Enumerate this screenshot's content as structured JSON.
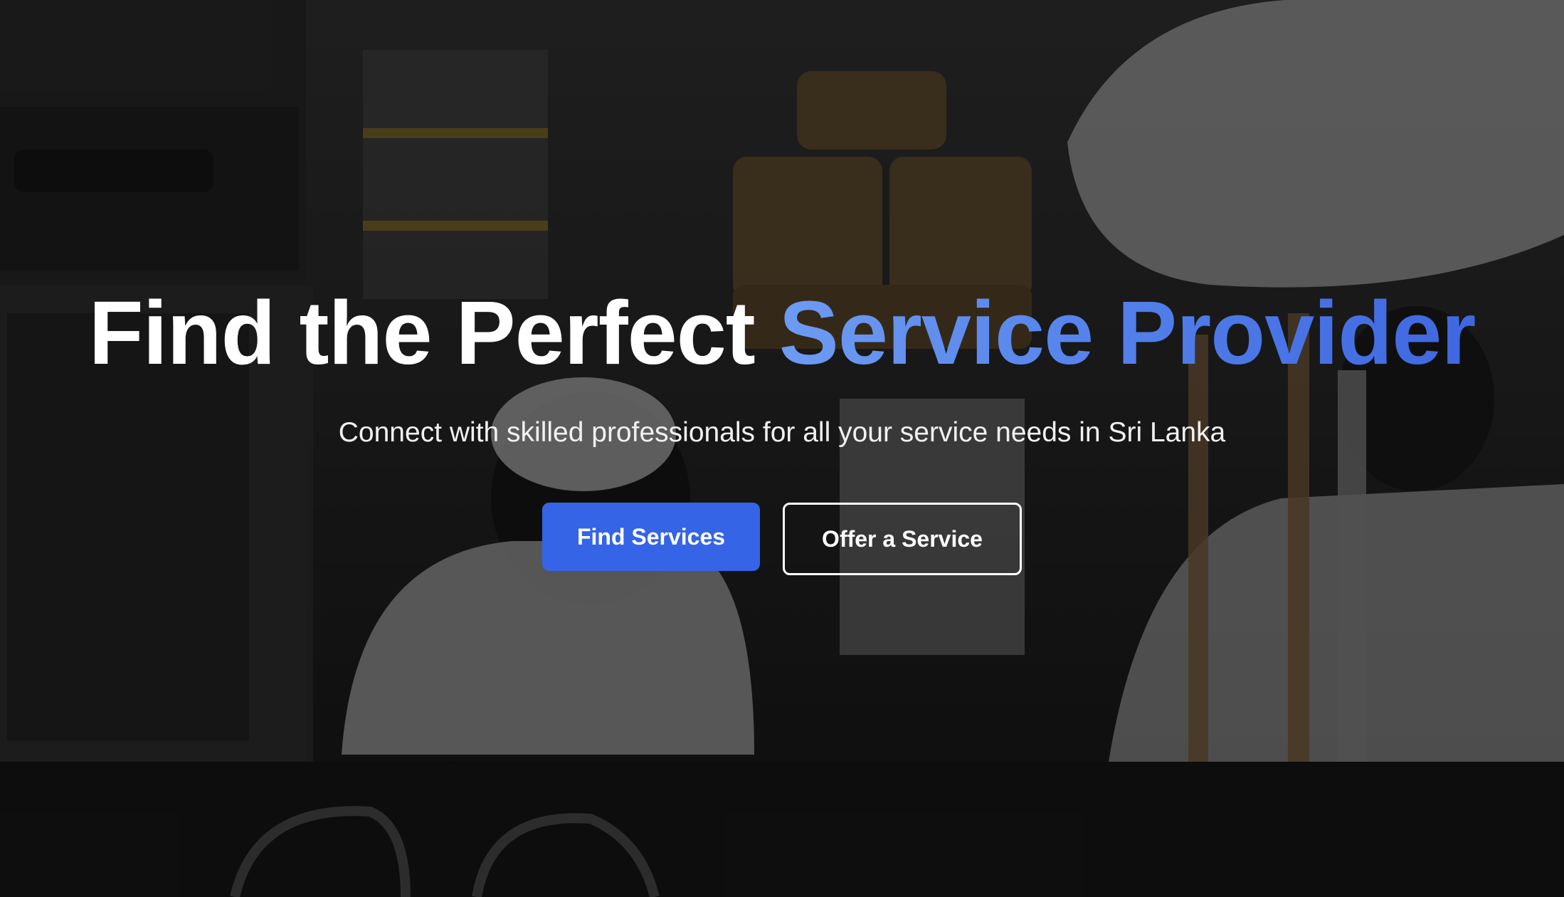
{
  "hero": {
    "headline_main": "Find the Perfect",
    "headline_accent": "Service Provider",
    "subtitle": "Connect with skilled professionals for all your service needs in Sri Lanka",
    "primary_button": "Find Services",
    "secondary_button": "Offer a Service"
  },
  "colors": {
    "primary": "#3564e6",
    "accent_gradient_start": "#6e9bf2",
    "accent_gradient_end": "#3f67e0",
    "text": "#ffffff"
  },
  "background": {
    "icon": "kitchen-photo-background"
  }
}
